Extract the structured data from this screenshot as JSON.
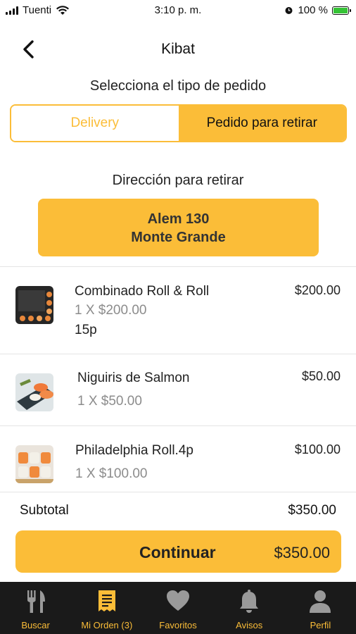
{
  "status_bar": {
    "carrier": "Tuenti",
    "time": "3:10 p. m.",
    "battery": "100 %"
  },
  "nav": {
    "title": "Kibat"
  },
  "order_type": {
    "label": "Selecciona el tipo de pedido",
    "options": [
      "Delivery",
      "Pedido para retirar"
    ],
    "selected": "Pedido para retirar"
  },
  "pickup": {
    "label": "Dirección para retirar",
    "address_line1": "Alem 130",
    "address_line2": "Monte Grande"
  },
  "items": [
    {
      "name": "Combinado Roll & Roll",
      "qty": "1 X $200.00",
      "note": "15p",
      "price": "$200.00"
    },
    {
      "name": "Niguiris de Salmon",
      "qty": "1 X $50.00",
      "price": "$50.00"
    },
    {
      "name": "Philadelphia Roll.4p",
      "qty": "1 X $100.00",
      "price": "$100.00"
    }
  ],
  "summary": {
    "subtotal_label": "Subtotal",
    "subtotal_value": "$350.00"
  },
  "cta": {
    "label": "Continuar",
    "price": "$350.00"
  },
  "tabbar": {
    "tabs": [
      {
        "label": "Buscar",
        "icon": "fork-knife-icon"
      },
      {
        "label": "Mi Orden (3)",
        "icon": "receipt-icon"
      },
      {
        "label": "Favoritos",
        "icon": "heart-icon"
      },
      {
        "label": "Avisos",
        "icon": "bell-icon"
      },
      {
        "label": "Perfil",
        "icon": "user-icon"
      }
    ]
  },
  "colors": {
    "accent": "#fbbd38",
    "tabbar_bg": "#1a1a1a",
    "muted_text": "#8c8c8c"
  }
}
